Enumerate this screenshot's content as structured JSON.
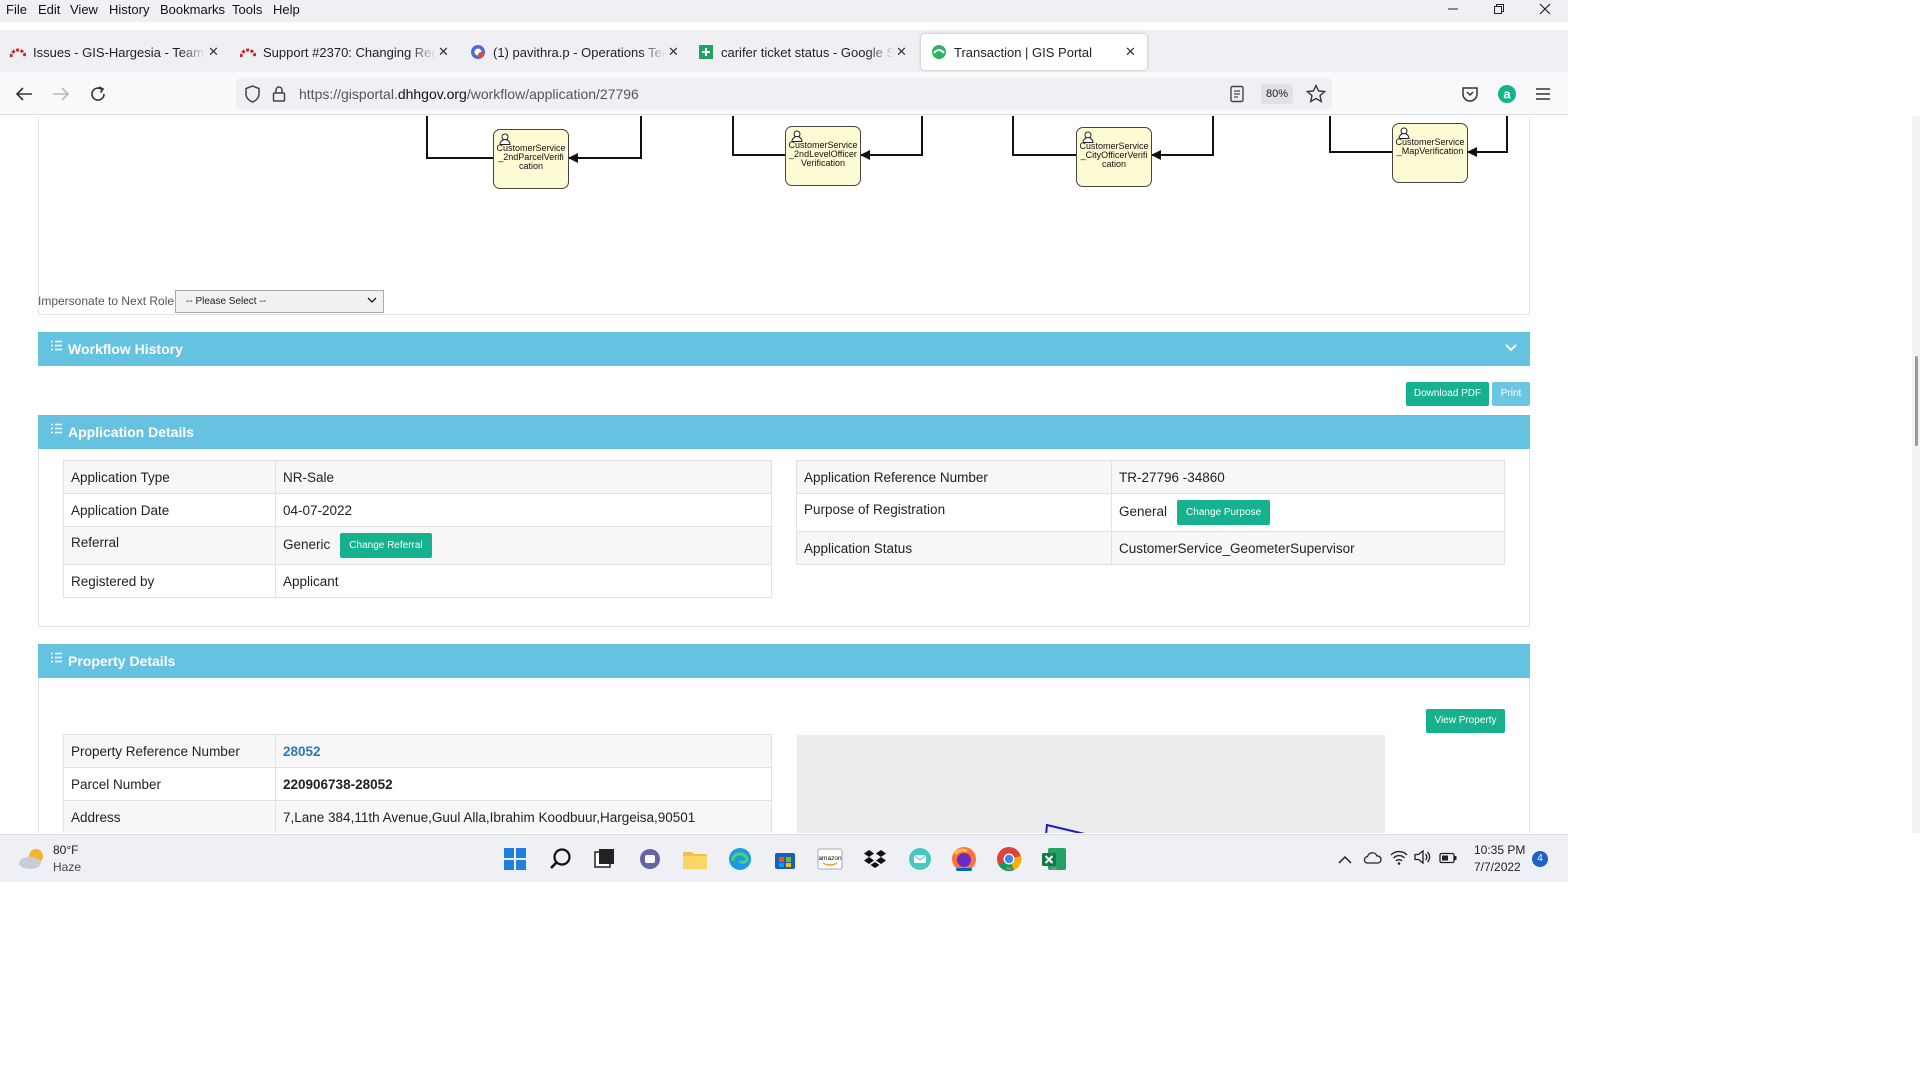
{
  "menubar": {
    "items": [
      "File",
      "Edit",
      "View",
      "History",
      "Bookmarks",
      "Tools",
      "Help"
    ]
  },
  "tabs": [
    {
      "title": "Issues - GIS-Hargesia - Teams Po",
      "icon": "redmine-icon"
    },
    {
      "title": "Support #2370: Changing Regis",
      "icon": "redmine-icon"
    },
    {
      "title": "(1) pavithra.p - Operations Team",
      "icon": "teams-icon"
    },
    {
      "title": "carifer ticket status - Google Sh",
      "icon": "sheets-icon"
    },
    {
      "title": "Transaction | GIS Portal",
      "icon": "gis-portal-icon"
    }
  ],
  "address_bar": {
    "prefix": "https://gisportal.",
    "domain": "dhhgov.org",
    "path": "/workflow/application/27796",
    "zoom": "80%"
  },
  "workflow": {
    "nodes": [
      "CustomerService_2ndParcelVerification",
      "CustomerService_2ndLevelOfficerVerification",
      "CustomerService_CityOfficerVerification",
      "CustomerService_MapVerification"
    ],
    "impersonate_label": "Impersonate to Next Role",
    "impersonate_value": "-- Please Select --"
  },
  "sections": {
    "workflow_history": "Workflow History",
    "application_details": "Application Details",
    "property_details": "Property Details"
  },
  "actions": {
    "download_pdf": "Download PDF",
    "print": "Print",
    "change_referral": "Change Referral",
    "change_purpose": "Change Purpose",
    "view_property": "View Property"
  },
  "application_details": {
    "left": [
      {
        "label": "Application Type",
        "value": "NR-Sale"
      },
      {
        "label": "Application Date",
        "value": "04-07-2022"
      },
      {
        "label": "Referral",
        "value": "Generic"
      },
      {
        "label": "Registered by",
        "value": "Applicant"
      }
    ],
    "right": [
      {
        "label": "Application Reference Number",
        "value": "TR-27796 -34860"
      },
      {
        "label": "Purpose of Registration",
        "value": "General"
      },
      {
        "label": "Application Status",
        "value": "CustomerService_GeometerSupervisor"
      }
    ]
  },
  "property_details": [
    {
      "label": "Property Reference Number",
      "value": "28052"
    },
    {
      "label": "Parcel Number",
      "value": "220906738-28052"
    },
    {
      "label": "Address",
      "value": "7,Lane 384,11th Avenue,Guul Alla,Ibrahim Koodbuur,Hargeisa,90501"
    }
  ],
  "taskbar": {
    "weather_temp": "80°F",
    "weather_desc": "Haze",
    "time": "10:35 PM",
    "date": "7/7/2022",
    "notifications": "4"
  },
  "colors": {
    "section_header": "#65c2e0",
    "button_green": "#16b28f",
    "workflow_node": "#fdfbd3",
    "link": "#2a7ab8"
  }
}
